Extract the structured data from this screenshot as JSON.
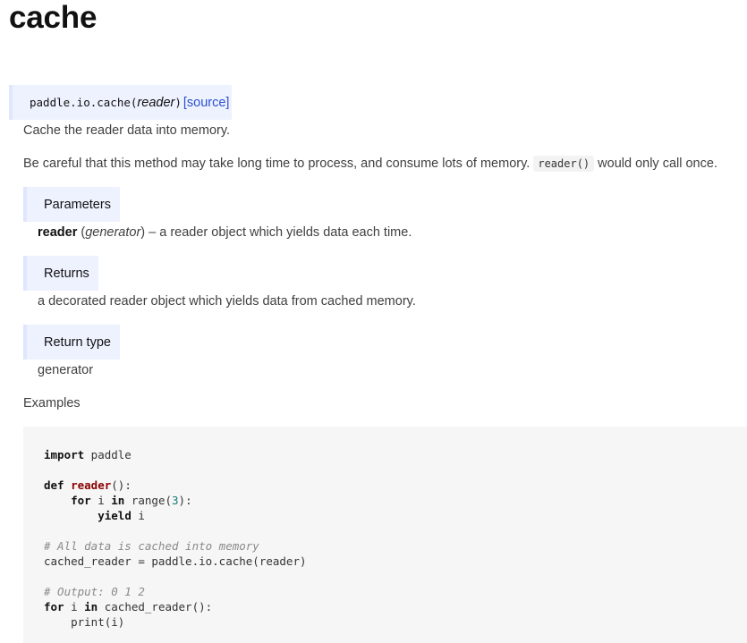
{
  "page": {
    "title": "cache"
  },
  "signature": {
    "module_path": "paddle.io.cache(",
    "param": "reader",
    "close_paren": ")",
    "source_link": "[source]"
  },
  "description": {
    "summary": "Cache the reader data into memory.",
    "warning_before": "Be careful that this method may take long time to process, and consume lots of memory. ",
    "warning_code": "reader()",
    "warning_after": " would only call once."
  },
  "parameters": {
    "heading": "Parameters",
    "name": "reader",
    "type": "generator",
    "desc": " – a reader object which yields data each time."
  },
  "returns": {
    "heading": "Returns",
    "desc": "a decorated reader object which yields data from cached memory."
  },
  "return_type": {
    "heading": "Return type",
    "value": "generator"
  },
  "examples": {
    "heading": "Examples",
    "code": {
      "l1_kw": "import",
      "l1_rest": " paddle",
      "l3_kw": "def",
      "l3_fn": "reader",
      "l3_rest": "():",
      "l4_indent": "    ",
      "l4_kw1": "for",
      "l4_mid": " i ",
      "l4_kw2": "in",
      "l4_call": " range(",
      "l4_num": "3",
      "l4_end": "):",
      "l5_indent": "        ",
      "l5_kw": "yield",
      "l5_rest": " i",
      "l7_comment": "# All data is cached into memory",
      "l8": "cached_reader = paddle.io.cache(reader)",
      "l10_comment": "# Output: 0 1 2",
      "l11_kw1": "for",
      "l11_mid": " i ",
      "l11_kw2": "in",
      "l11_rest": " cached_reader():",
      "l12": "    print(i)"
    }
  }
}
